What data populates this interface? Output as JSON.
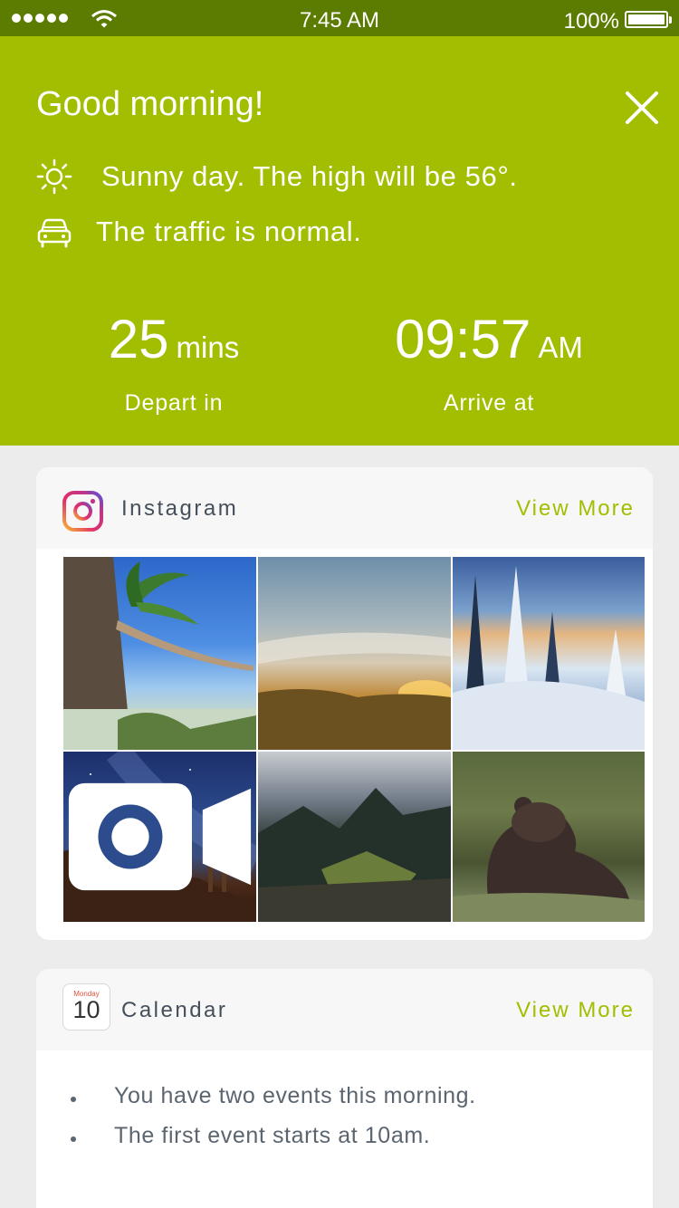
{
  "status_bar": {
    "time": "7:45 AM",
    "battery": "100%"
  },
  "hero": {
    "greeting": "Good morning!",
    "weather_text": "Sunny day. The high will be 56°.",
    "traffic_text": "The traffic is normal.",
    "depart": {
      "value": "25",
      "unit": "mins",
      "label": "Depart in"
    },
    "arrive": {
      "value": "09:57",
      "unit": "AM",
      "label": "Arrive at"
    },
    "icons": [
      "sun-icon",
      "car-icon",
      "close-icon"
    ]
  },
  "instagram": {
    "title": "Instagram",
    "view_more": "View More",
    "photos": [
      "palm-tree-beach",
      "golden-hills-sunset",
      "snowy-forest-sunset",
      "starry-desert-cactus",
      "mountain-ruins",
      "brown-bear"
    ],
    "video_badge_on": "starry-desert-cactus"
  },
  "calendar": {
    "icon_day": "Monday",
    "icon_date": "10",
    "title": "Calendar",
    "view_more": "View More",
    "items": [
      "You have two events this morning.",
      "The first event starts at 10am."
    ]
  },
  "colors": {
    "accent": "#a3bd00",
    "status_bar": "#5b7c00",
    "background": "#ececec"
  }
}
